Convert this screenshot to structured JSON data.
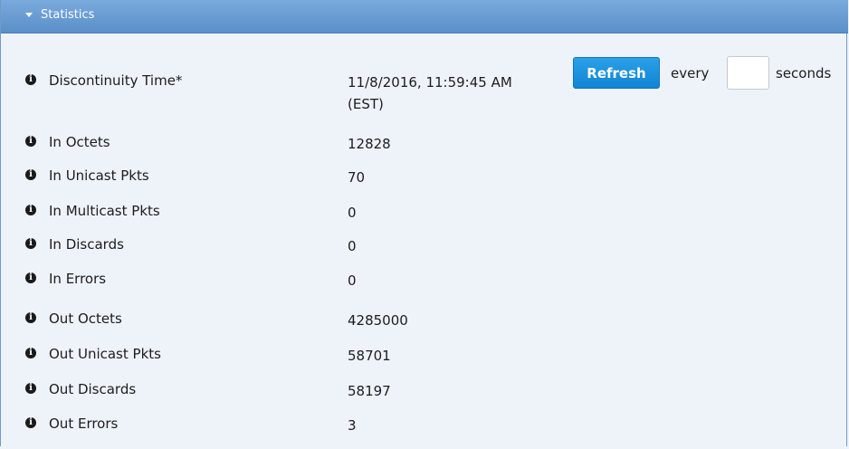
{
  "section": {
    "title": "Statistics"
  },
  "refresh": {
    "button_label": "Refresh",
    "every_label": "every",
    "interval_value": "",
    "seconds_label": "seconds"
  },
  "stats": [
    {
      "label": "Discontinuity Time*",
      "value_line1": "11/8/2016, 11:59:45 AM",
      "value_line2": "(EST)"
    },
    {
      "label": "In Octets",
      "value": "12828"
    },
    {
      "label": "In Unicast Pkts",
      "value": "70"
    },
    {
      "label": "In Multicast Pkts",
      "value": "0"
    },
    {
      "label": "In Discards",
      "value": "0"
    },
    {
      "label": "In Errors",
      "value": "0"
    },
    {
      "label": "Out Octets",
      "value": "4285000"
    },
    {
      "label": "Out Unicast Pkts",
      "value": "58701"
    },
    {
      "label": "Out Discards",
      "value": "58197"
    },
    {
      "label": "Out Errors",
      "value": "3"
    }
  ],
  "icons": {
    "info": "info-icon",
    "collapse": "caret-down-icon"
  },
  "colors": {
    "header": "#5a8fc8",
    "panel_background": "#eef3fa",
    "button": "#1a8fdc"
  }
}
